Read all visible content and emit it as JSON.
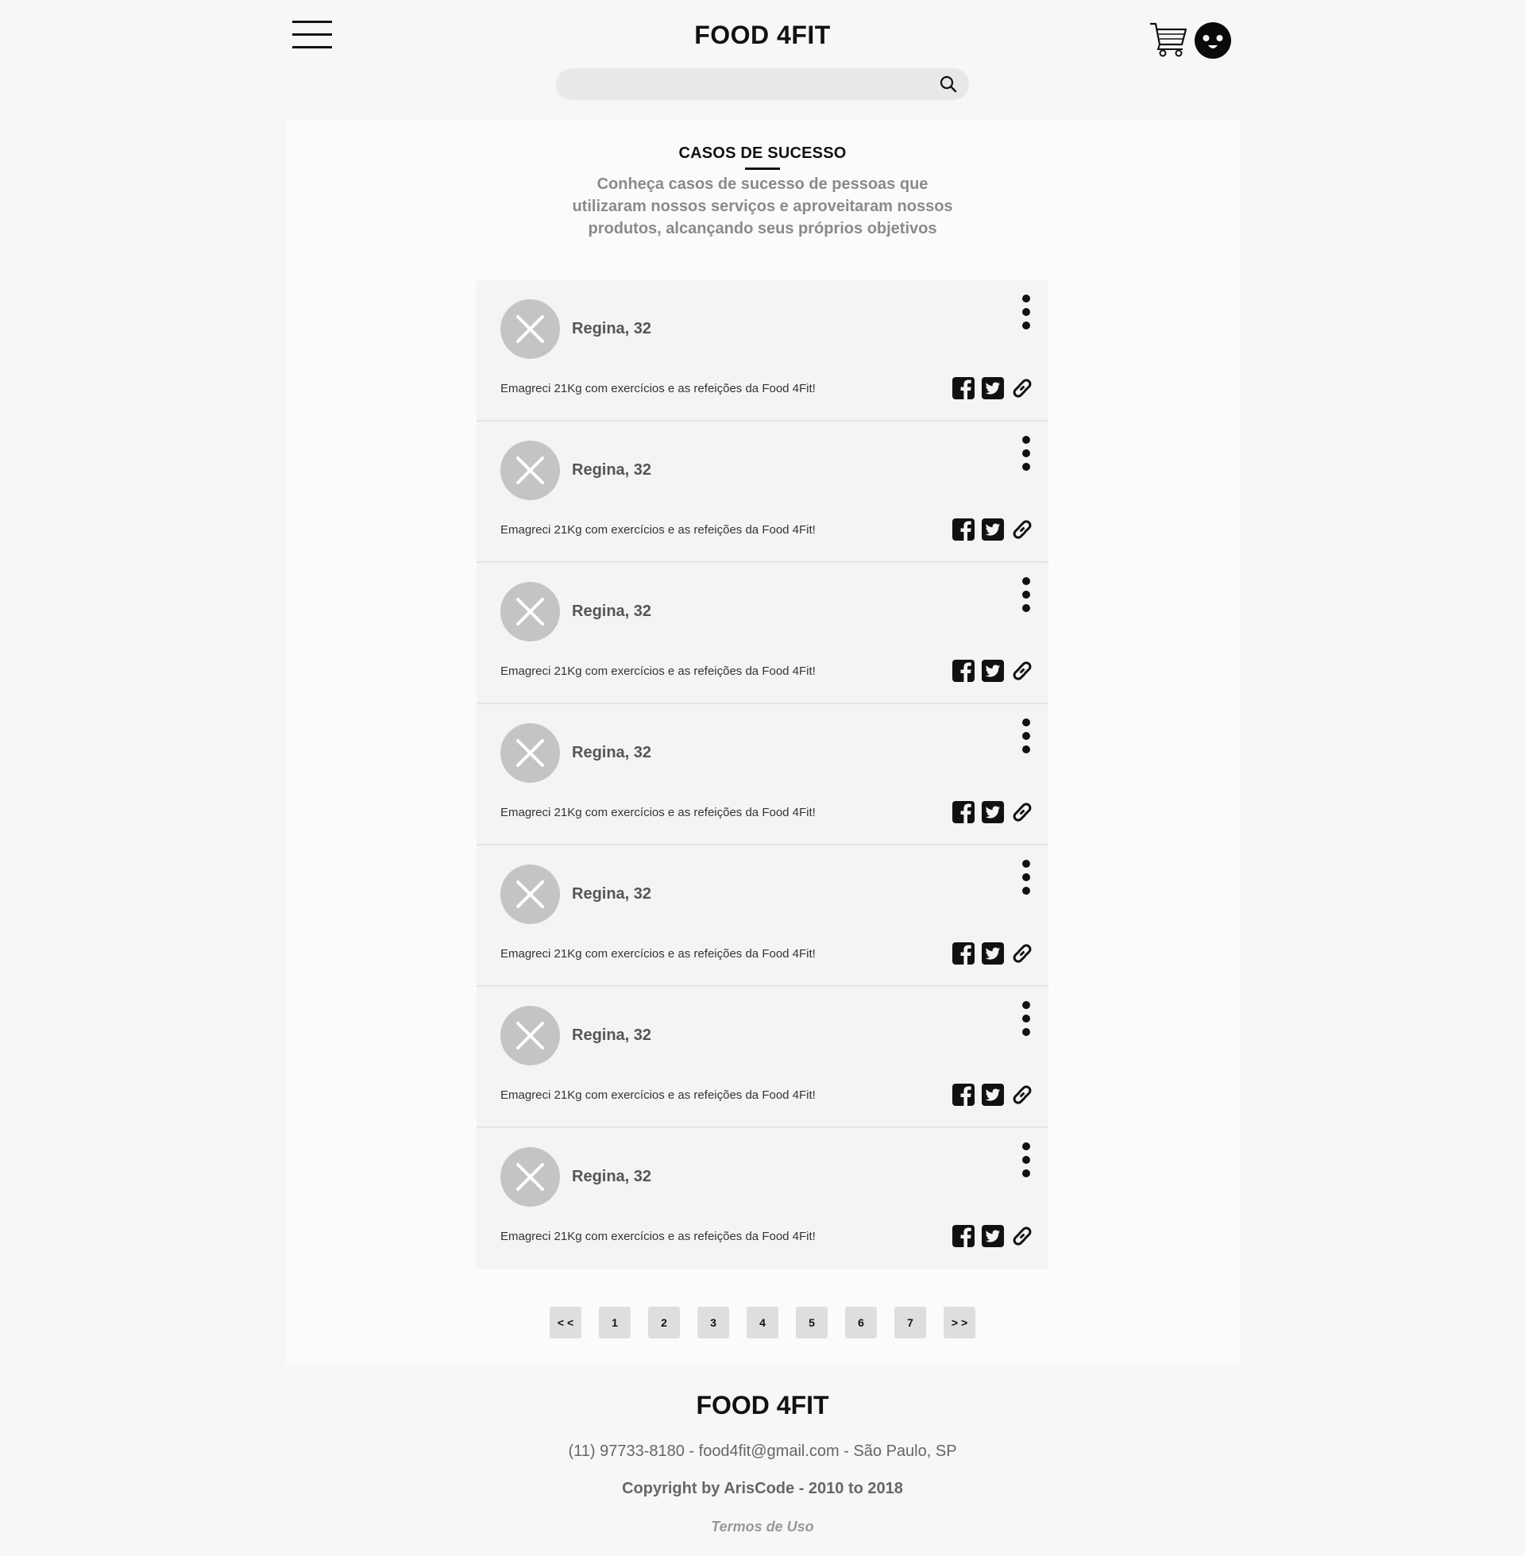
{
  "header": {
    "brand": "FOOD 4FIT",
    "search_placeholder": "",
    "icons": [
      "menu-icon",
      "search-icon",
      "cart-icon",
      "avatar-icon"
    ]
  },
  "section": {
    "title": "CASOS DE SUCESSO",
    "description": "Conheça casos de sucesso de pessoas que utilizaram nossos serviços e aproveitaram nossos produtos, alcançando seus próprios objetivos"
  },
  "cards": [
    {
      "name": "Regina, 32",
      "text": "Emagreci 21Kg com exercícios e as refeições da Food 4Fit!"
    },
    {
      "name": "Regina, 32",
      "text": "Emagreci 21Kg com exercícios e as refeições da Food 4Fit!"
    },
    {
      "name": "Regina, 32",
      "text": "Emagreci 21Kg com exercícios e as refeições da Food 4Fit!"
    },
    {
      "name": "Regina, 32",
      "text": "Emagreci 21Kg com exercícios e as refeições da Food 4Fit!"
    },
    {
      "name": "Regina, 32",
      "text": "Emagreci 21Kg com exercícios e as refeições da Food 4Fit!"
    },
    {
      "name": "Regina, 32",
      "text": "Emagreci 21Kg com exercícios e as refeições da Food 4Fit!"
    },
    {
      "name": "Regina, 32",
      "text": "Emagreci 21Kg com exercícios e as refeições da Food 4Fit!"
    }
  ],
  "card_icons": [
    "avatar-placeholder-icon",
    "more-vertical-icon",
    "facebook-icon",
    "twitter-icon",
    "link-icon"
  ],
  "pagination": {
    "prev": "< <",
    "pages": [
      "1",
      "2",
      "3",
      "4",
      "5",
      "6",
      "7"
    ],
    "next": "> >"
  },
  "footer": {
    "brand": "FOOD 4FIT",
    "contact": "(11) 97733-8180 - food4fit@gmail.com - São Paulo, SP",
    "copyright": "Copyright by ArisCode - 2010 to 2018",
    "terms": "Termos de Uso"
  },
  "colors": {
    "background": "#f7f7f7",
    "panel": "#fbfbfb",
    "card": "#f4f4f4",
    "avatar_placeholder": "#c4c4c4",
    "text_dark": "#111111",
    "text_muted": "#8a8a8a",
    "page_button": "#dedede"
  }
}
